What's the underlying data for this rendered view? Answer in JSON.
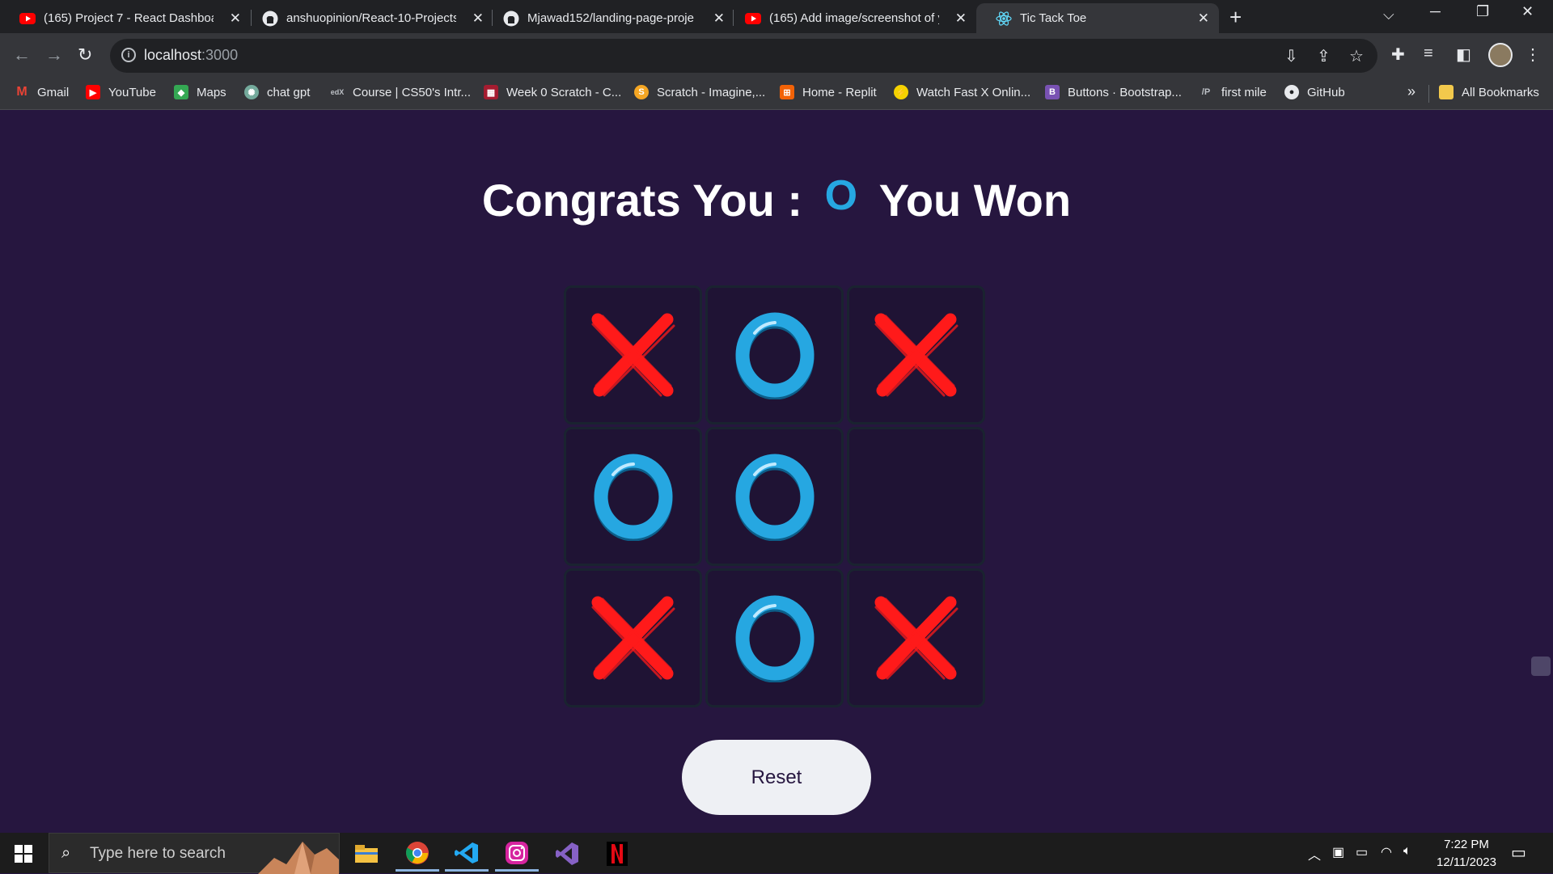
{
  "browser": {
    "tabs": [
      {
        "title": "(165) Project 7 - React Dashboar",
        "favicon": "youtube-icon"
      },
      {
        "title": "anshuopinion/React-10-Projects",
        "favicon": "github-icon"
      },
      {
        "title": "Mjawad152/landing-page-proje",
        "favicon": "github-icon"
      },
      {
        "title": "(165) Add image/screenshot of y",
        "favicon": "youtube-icon"
      },
      {
        "title": "Tic Tack Toe",
        "favicon": "react-icon"
      }
    ],
    "url_host": "localhost",
    "url_port": ":3000",
    "bookmarks": [
      {
        "label": "Gmail"
      },
      {
        "label": "YouTube"
      },
      {
        "label": "Maps"
      },
      {
        "label": "chat gpt"
      },
      {
        "label": "Course | CS50's Intr..."
      },
      {
        "label": "Week 0 Scratch - C..."
      },
      {
        "label": "Scratch - Imagine,..."
      },
      {
        "label": "Home - Replit"
      },
      {
        "label": "Watch Fast X Onlin..."
      },
      {
        "label": "Buttons · Bootstrap..."
      },
      {
        "label": "first mile"
      },
      {
        "label": "GitHub"
      }
    ],
    "bookmarks_overflow": "»",
    "all_bookmarks": "All Bookmarks"
  },
  "game": {
    "heading_prefix": "Congrats You :",
    "winner": "O",
    "heading_suffix": "You Won",
    "board": [
      "X",
      "O",
      "X",
      "O",
      "O",
      "",
      "X",
      "O",
      "X"
    ],
    "reset_label": "Reset",
    "colors": {
      "x": "#ff1a1a",
      "o": "#26a7e1",
      "background": "#26163f"
    }
  },
  "taskbar": {
    "search_placeholder": "Type here to search",
    "time": "7:22 PM",
    "date": "12/11/2023",
    "apps": [
      "file-explorer-icon",
      "chrome-icon",
      "vscode-icon",
      "instagram-icon",
      "visual-studio-icon",
      "netflix-icon"
    ]
  }
}
